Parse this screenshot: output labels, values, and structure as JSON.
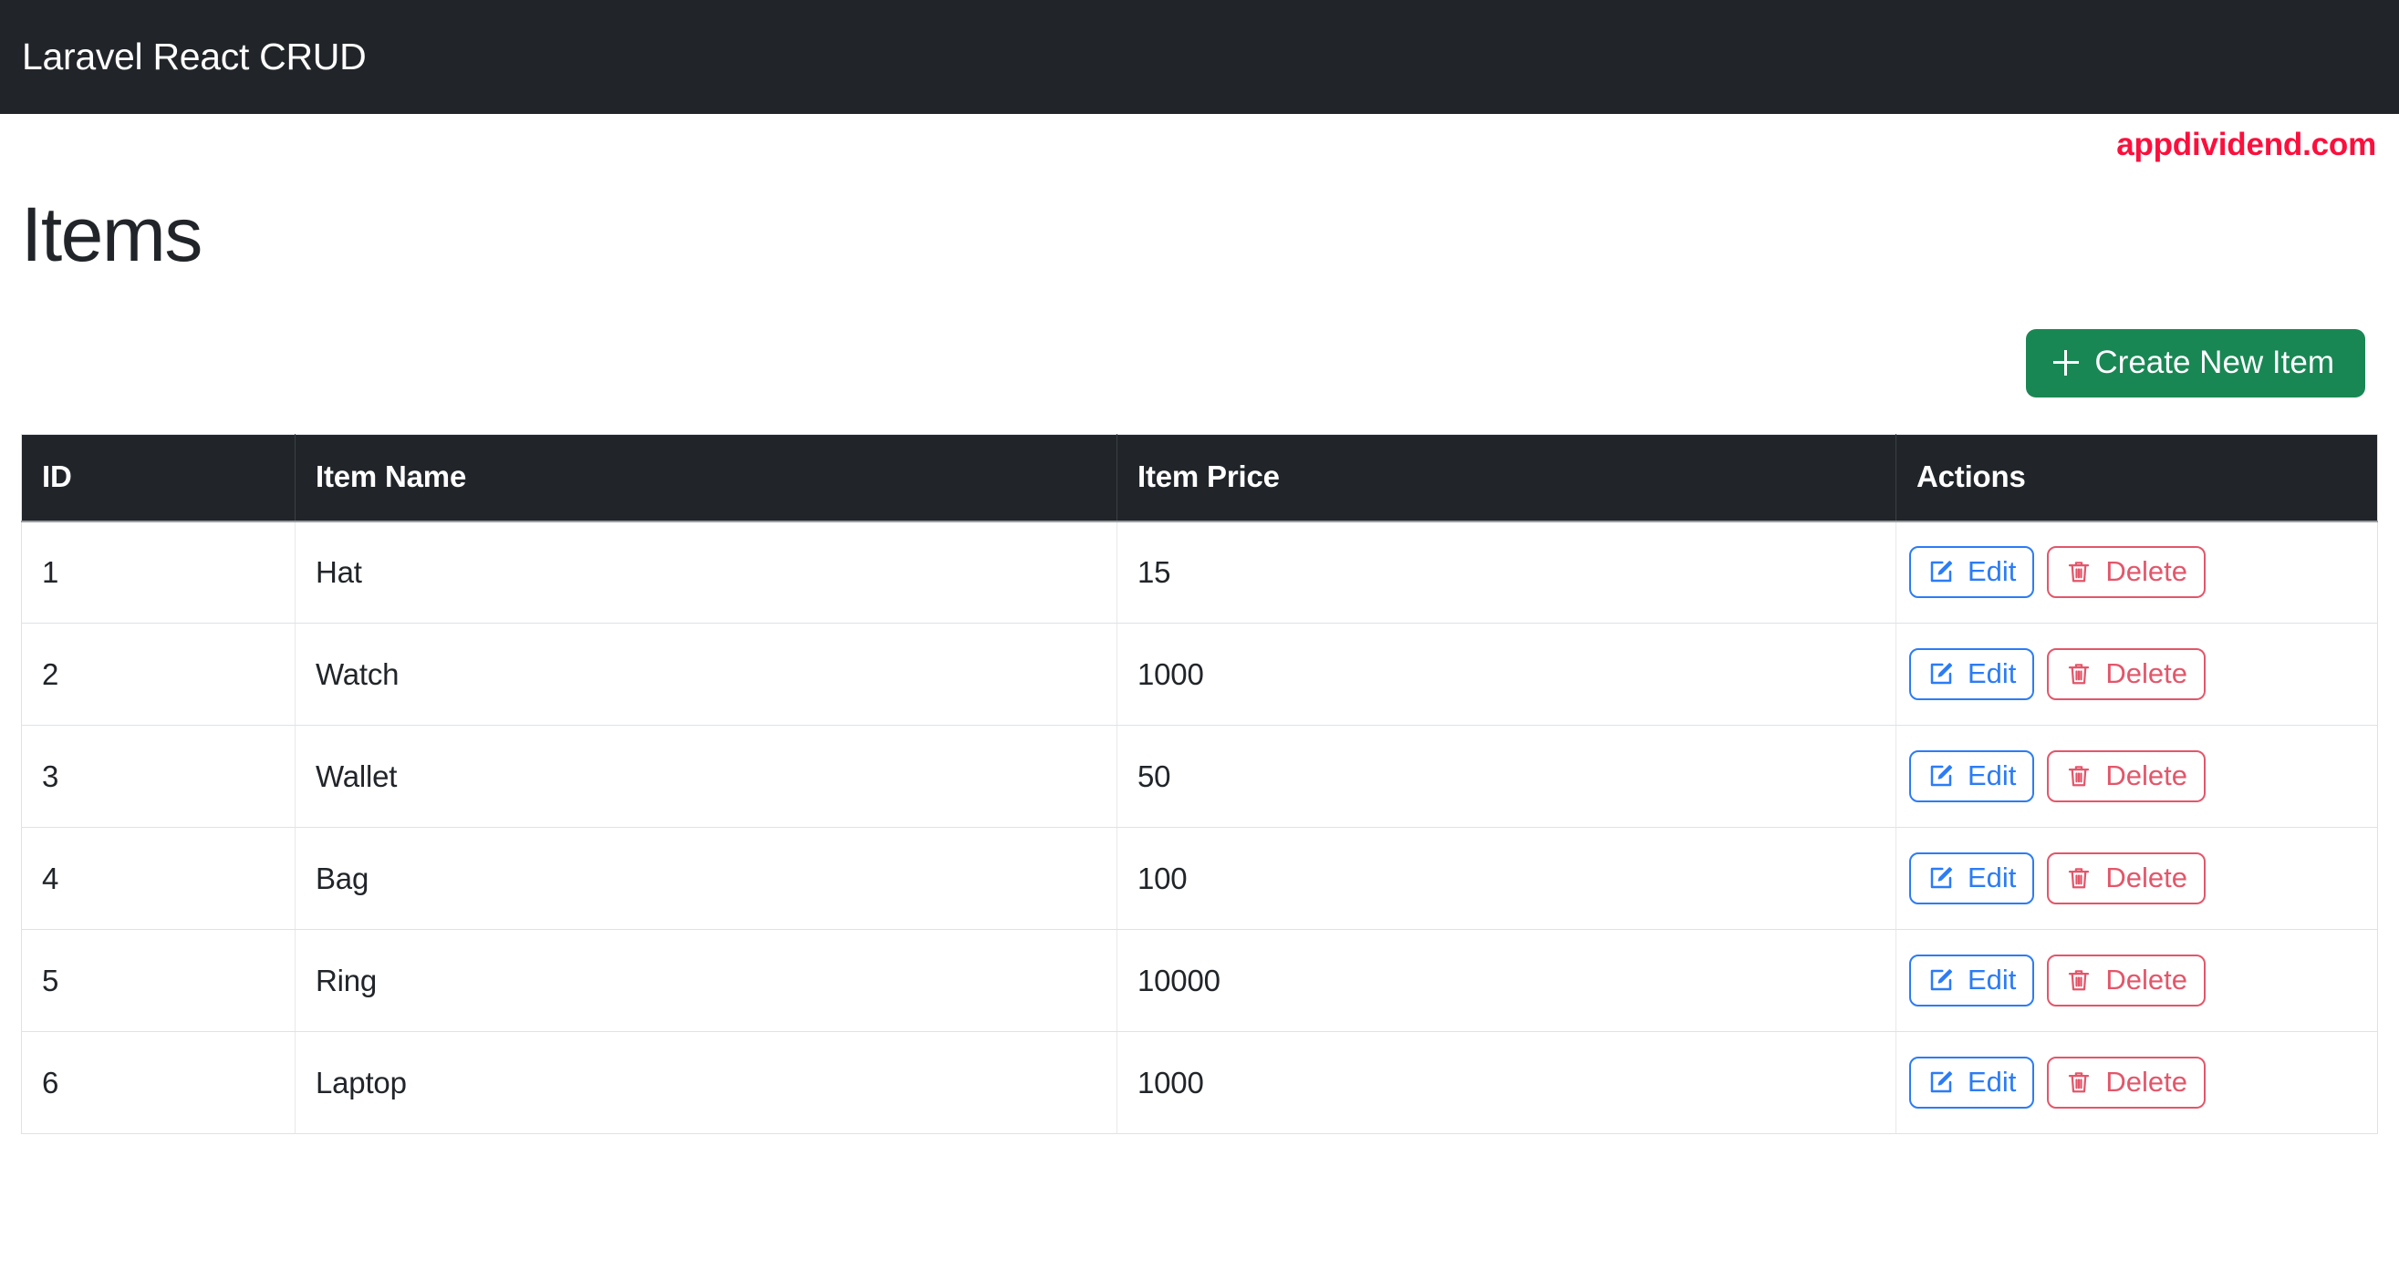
{
  "navbar": {
    "brand": "Laravel React CRUD"
  },
  "watermark": {
    "text": "appdividend.com",
    "color": "#fc0f3c"
  },
  "page": {
    "title": "Items"
  },
  "toolbar": {
    "create_label": "Create New Item",
    "create_icon": "plus-icon",
    "create_color": "#198754"
  },
  "table": {
    "headers": {
      "id": "ID",
      "name": "Item Name",
      "price": "Item Price",
      "actions": "Actions"
    },
    "header_bg": "#212529",
    "rows": [
      {
        "id": "1",
        "name": "Hat",
        "price": "15"
      },
      {
        "id": "2",
        "name": "Watch",
        "price": "1000"
      },
      {
        "id": "3",
        "name": "Wallet",
        "price": "50"
      },
      {
        "id": "4",
        "name": "Bag",
        "price": "100"
      },
      {
        "id": "5",
        "name": "Ring",
        "price": "10000"
      },
      {
        "id": "6",
        "name": "Laptop",
        "price": "1000"
      }
    ],
    "row_actions": {
      "edit_label": "Edit",
      "edit_icon": "pencil-square-icon",
      "edit_color": "#2b7cf6",
      "delete_label": "Delete",
      "delete_icon": "trash-icon",
      "delete_color": "#e3566a"
    }
  }
}
